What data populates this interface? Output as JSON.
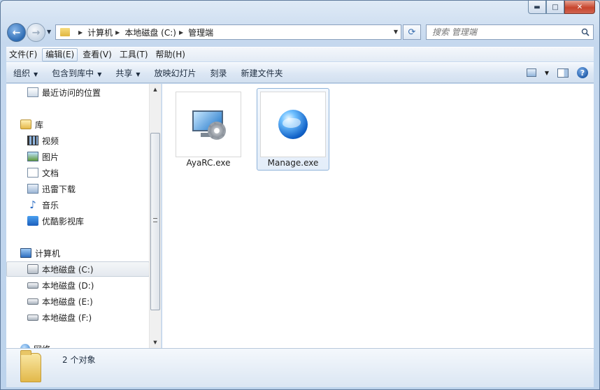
{
  "window": {
    "caption": {
      "minimize": "▬",
      "maximize": "□",
      "close": "✕"
    }
  },
  "address": {
    "back_glyph": "←",
    "forward_glyph": "→",
    "crumbs": [
      "计算机",
      "本地磁盘 (C:)",
      "管理端"
    ],
    "search_placeholder": "搜索 管理端",
    "refresh_glyph": "⟳"
  },
  "menubar": {
    "items": [
      "文件(F)",
      "编辑(E)",
      "查看(V)",
      "工具(T)",
      "帮助(H)"
    ]
  },
  "commandbar": {
    "items": [
      "组织",
      "包含到库中",
      "共享",
      "放映幻灯片",
      "刻录",
      "新建文件夹"
    ],
    "help_glyph": "?"
  },
  "navpane": {
    "recent": "最近访问的位置",
    "libraries": "库",
    "lib_items": [
      "视频",
      "图片",
      "文档",
      "迅雷下载",
      "音乐",
      "优酷影视库"
    ],
    "computer": "计算机",
    "drives": [
      "本地磁盘 (C:)",
      "本地磁盘 (D:)",
      "本地磁盘 (E:)",
      "本地磁盘 (F:)"
    ],
    "network": "网络"
  },
  "files": [
    {
      "name": "AyaRC.exe",
      "icon": "remote-control-gear-icon",
      "selected": false
    },
    {
      "name": "Manage.exe",
      "icon": "globe-icon",
      "selected": true
    }
  ],
  "details": {
    "status": "2 个对象"
  },
  "colors": {
    "selection_border": "#8fb3da",
    "frame": "#bcd3ec"
  }
}
